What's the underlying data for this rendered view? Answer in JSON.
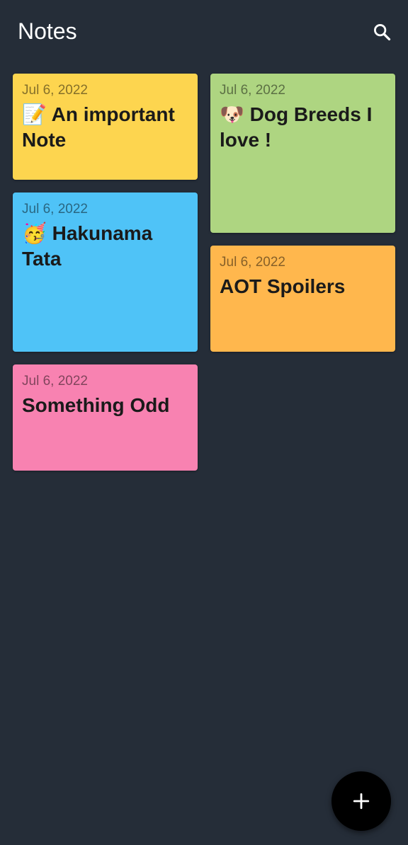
{
  "app_bar": {
    "title": "Notes",
    "search_icon": "search-icon"
  },
  "notes": [
    {
      "date": "Jul 6, 2022",
      "title": "📝 An important Note",
      "color": "#fdd54f"
    },
    {
      "date": "Jul 6, 2022",
      "title": "🐶 Dog Breeds I love !",
      "color": "#aed581"
    },
    {
      "date": "Jul 6, 2022",
      "title": "🥳 Hakunama Tata",
      "color": "#4fc3f7"
    },
    {
      "date": "Jul 6, 2022",
      "title": "AOT Spoilers",
      "color": "#ffb74d"
    },
    {
      "date": "Jul 6, 2022",
      "title": "Something Odd",
      "color": "#f882b1"
    }
  ],
  "fab": {
    "icon": "plus-icon",
    "color": "#000000"
  }
}
